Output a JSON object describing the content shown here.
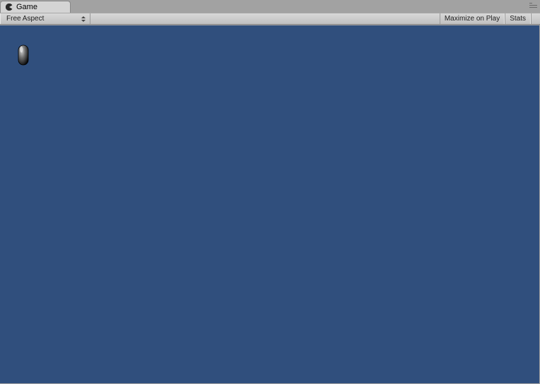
{
  "tab": {
    "label": "Game",
    "icon_name": "pacman-icon"
  },
  "toolbar": {
    "aspect_label": "Free Aspect",
    "maximize_label": "Maximize on Play",
    "stats_label": "Stats"
  },
  "viewport": {
    "background_color": "#304f7d"
  }
}
